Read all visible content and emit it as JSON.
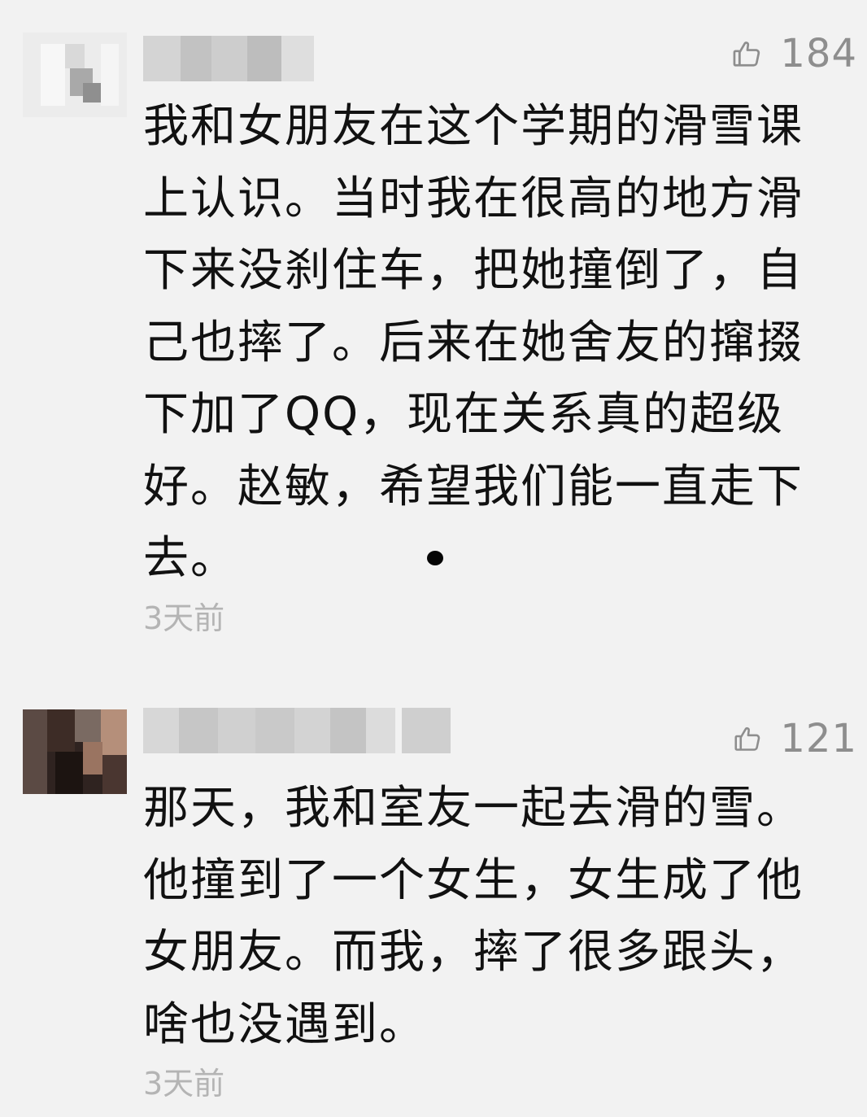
{
  "comments": [
    {
      "username": "",
      "likes": "184",
      "text": "我和女朋友在这个学期的滑雪课\n上认识。当时我在很高的地方滑\n下来没刹住车，把她撞倒了，自\n己也摔了。后来在她舍友的撺掇\n下加了QQ，现在关系真的超级\n好。赵敏，希望我们能一直走下\n去。",
      "time": "3天前"
    },
    {
      "username": "",
      "likes": "121",
      "text": "那天，我和室友一起去滑的雪。\n他撞到了一个女生，女生成了他\n女朋友。而我，摔了很多跟头，\n啥也没遇到。",
      "time": "3天前"
    }
  ],
  "icons": {
    "like": "thumbs-up-icon"
  },
  "colors": {
    "background": "#f2f2f2",
    "text": "#111111",
    "meta": "#8e8e8e",
    "timestamp": "#b4b4b4"
  }
}
